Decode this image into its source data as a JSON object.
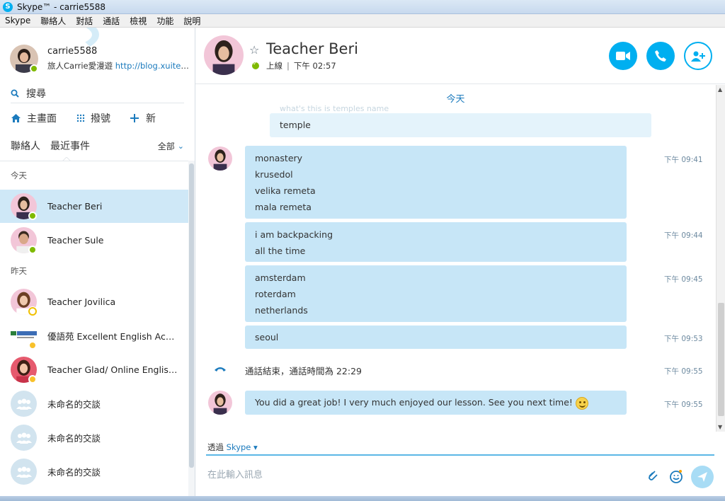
{
  "window": {
    "title": "Skype™ - carrie5588",
    "logo": "S"
  },
  "menu": [
    "Skype",
    "聯絡人",
    "對話",
    "通話",
    "檢視",
    "功能",
    "說明"
  ],
  "profile": {
    "name": "carrie5588",
    "mood_text": "旅人Carrie愛漫遊 ",
    "mood_link": "http://blog.xuite.n...",
    "status": "online"
  },
  "search": {
    "label": "搜尋",
    "icon": "search-icon"
  },
  "nav": {
    "home": "主畫面",
    "dialpad": "撥號",
    "new": "新"
  },
  "tabs": {
    "contacts": "聯絡人",
    "recent": "最近事件",
    "filter": "全部"
  },
  "sections": {
    "today": "今天",
    "yesterday": "昨天"
  },
  "recent_list": [
    {
      "name": "Teacher Beri",
      "status": "online"
    },
    {
      "name": "Teacher Sule",
      "status": "online"
    },
    {
      "name": "Teacher Jovilica",
      "status": "away"
    },
    {
      "name": "優語苑 Excellent English Acad...",
      "status": "clock"
    },
    {
      "name": "Teacher Glad/ Online English...",
      "status": "clock"
    },
    {
      "name": "未命名的交談",
      "status": "group"
    },
    {
      "name": "未命名的交談",
      "status": "group"
    },
    {
      "name": "未命名的交談",
      "status": "group"
    }
  ],
  "chat": {
    "contact_name": "Teacher Beri",
    "status_text": "上線",
    "separator": "|",
    "local_time": "下午 02:57",
    "date_divider": "今天",
    "ghost_text": "what's this is temples name",
    "messages": [
      {
        "lines": [
          "temple"
        ],
        "time": ""
      },
      {
        "lines": [
          "monastery",
          "krusedol",
          "velika remeta",
          "mala remeta"
        ],
        "time": "下午 09:41"
      },
      {
        "lines": [
          "i am backpacking",
          "all the time"
        ],
        "time": "下午 09:44"
      },
      {
        "lines": [
          "amsterdam",
          "roterdam",
          "netherlands"
        ],
        "time": "下午 09:45"
      },
      {
        "lines": [
          "seoul"
        ],
        "time": "下午 09:53"
      }
    ],
    "call_ended": {
      "text": "通話結束，通話時間為 22:29",
      "time": "下午 09:55"
    },
    "last_message": {
      "text": "You did a great job! I very much enjoyed our lesson. See you next time!",
      "time": "下午 09:55"
    }
  },
  "compose": {
    "via_label": "透過",
    "via_service": "Skype ▾",
    "placeholder": "在此輸入訊息"
  },
  "colors": {
    "accent": "#00aff0",
    "bubble": "#c7e6f7",
    "selected_row": "#cfe8f7",
    "online": "#7fba00"
  }
}
